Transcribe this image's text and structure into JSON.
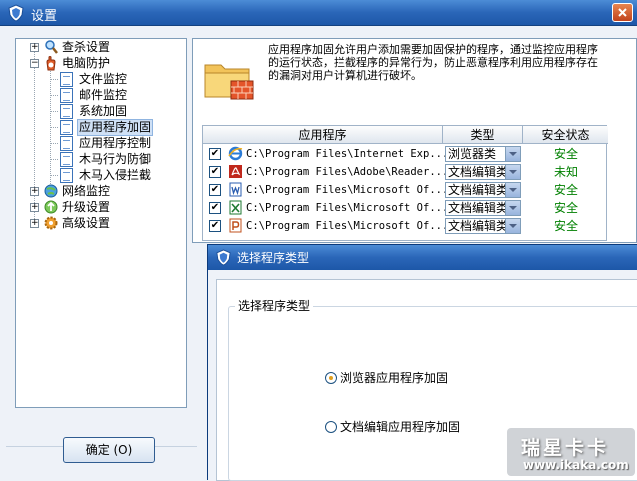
{
  "window": {
    "title": "设置"
  },
  "tree": {
    "items": [
      {
        "label": "查杀设置"
      },
      {
        "label": "电脑防护"
      },
      {
        "label": "文件监控"
      },
      {
        "label": "邮件监控"
      },
      {
        "label": "系统加固"
      },
      {
        "label": "应用程序加固"
      },
      {
        "label": "应用程序控制"
      },
      {
        "label": "木马行为防御"
      },
      {
        "label": "木马入侵拦截"
      },
      {
        "label": "网络监控"
      },
      {
        "label": "升级设置"
      },
      {
        "label": "高级设置"
      }
    ],
    "selected": "应用程序加固"
  },
  "ok_button": {
    "label": "确定 (O)"
  },
  "description": "应用程序加固允许用户添加需要加固保护的程序，通过监控应用程序的运行状态，拦截程序的异常行为，防止恶意程序利用应用程序存在的漏洞对用户计算机进行破坏。",
  "table": {
    "headers": {
      "app": "应用程序",
      "type": "类型",
      "status": "安全状态"
    },
    "rows": [
      {
        "checked": "✔",
        "icon": "ie-icon",
        "path": "C:\\Program Files\\Internet Exp...",
        "type": "浏览器类",
        "status": "安全",
        "status_color": "#008000"
      },
      {
        "checked": "✔",
        "icon": "pdf-icon",
        "path": "C:\\Program Files\\Adobe\\Reader...",
        "type": "文档编辑类",
        "status": "未知",
        "status_color": "#008000"
      },
      {
        "checked": "✔",
        "icon": "word-icon",
        "path": "C:\\Program Files\\Microsoft Of...",
        "type": "文档编辑类",
        "status": "安全",
        "status_color": "#008000"
      },
      {
        "checked": "✔",
        "icon": "excel-icon",
        "path": "C:\\Program Files\\Microsoft Of...",
        "type": "文档编辑类",
        "status": "安全",
        "status_color": "#008000"
      },
      {
        "checked": "✔",
        "icon": "ppt-icon",
        "path": "C:\\Program Files\\Microsoft Of...",
        "type": "文档编辑类",
        "status": "安全",
        "status_color": "#008000"
      }
    ]
  },
  "dialog": {
    "title": "选择程序类型",
    "group_label": "选择程序类型",
    "options": [
      {
        "label": "浏览器应用程序加固",
        "selected": true
      },
      {
        "label": "文档编辑应用程序加固",
        "selected": false
      }
    ]
  },
  "watermark": {
    "brand": "瑞星卡卡",
    "url": "www.ikaka.com"
  },
  "colors": {
    "titlebar": "#2a66b8",
    "status_ok": "#008000",
    "selection": "#cfe0f5"
  }
}
